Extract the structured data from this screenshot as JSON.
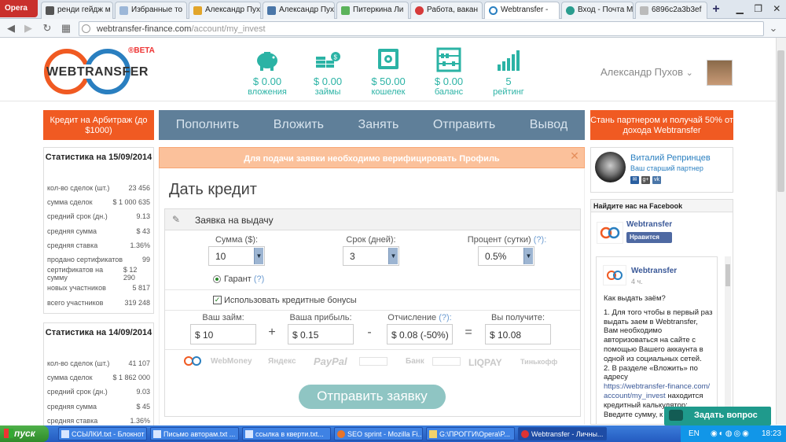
{
  "browser": {
    "opera_label": "Opera",
    "tabs": [
      {
        "label": "ренди гейдж м",
        "active": false
      },
      {
        "label": "Избранные то",
        "active": false
      },
      {
        "label": "Александр Пух",
        "active": false
      },
      {
        "label": "Александр Пух",
        "active": false
      },
      {
        "label": "Питеркина Ли",
        "active": false
      },
      {
        "label": "Работа, вакан",
        "active": false
      },
      {
        "label": "Webtransfer -",
        "active": true
      },
      {
        "label": "Вход - Почта М",
        "active": false
      },
      {
        "label": "6896c2a3b3ef",
        "active": false
      }
    ],
    "new_tab": "+",
    "url_host": "webtransfer-finance.com",
    "url_path": "/account/my_invest"
  },
  "header": {
    "logo_text": "WEBTRANSFER",
    "logo_badge": "®BETA",
    "stats": [
      {
        "icon": "piggy-bank-icon",
        "value": "$ 0.00",
        "label": "вложения"
      },
      {
        "icon": "coins-stack-icon",
        "value": "$ 0.00",
        "label": "займы"
      },
      {
        "icon": "safe-icon",
        "value": "$ 50.00",
        "label": "кошелек"
      },
      {
        "icon": "abacus-icon",
        "value": "$ 0.00",
        "label": "баланс"
      },
      {
        "icon": "rating-chart-icon",
        "value": "5",
        "label": "рейтинг"
      }
    ],
    "username": "Александр Пухов"
  },
  "nav": {
    "credit_arbitrage": "Кредит на Арбитраж (до $1000)",
    "items": [
      "Пополнить",
      "Вложить",
      "Занять",
      "Отправить",
      "Вывод"
    ],
    "partner_promo": "Стань партнером и получай 50% от дохода Webtransfer"
  },
  "stats_blocks": [
    {
      "title": "Статистика на 15/09/2014",
      "rows": [
        [
          "кол-во сделок (шт.)",
          "23 456"
        ],
        [
          "сумма сделок",
          "$ 1 000 635"
        ],
        [
          "средний срок (дн.)",
          "9.13"
        ],
        [
          "средняя сумма",
          "$ 43"
        ],
        [
          "средняя ставка",
          "1.36%"
        ],
        [
          "продано сертификатов",
          "99"
        ],
        [
          "сертификатов на сумму",
          "$ 12 290"
        ],
        [
          "новых участников",
          "5 817"
        ],
        [
          "всего участников",
          "319 248"
        ]
      ]
    },
    {
      "title": "Статистика на 14/09/2014",
      "rows": [
        [
          "кол-во сделок (шт.)",
          "41 107"
        ],
        [
          "сумма сделок",
          "$ 1 862 000"
        ],
        [
          "средний срок (дн.)",
          "9.03"
        ],
        [
          "средняя сумма",
          "$ 45"
        ],
        [
          "средняя ставка",
          "1.36%"
        ]
      ]
    }
  ],
  "main": {
    "alert": "Для подачи заявки необходимо верифицировать Профиль",
    "alert_close": "✕",
    "title": "Дать кредит",
    "form_header": "Заявка на выдачу",
    "sum_label": "Сумма ($):",
    "sum_value": "10",
    "term_label": "Срок (дней):",
    "term_value": "3",
    "percent_label": "Процент (сутки)",
    "percent_q": "(?):",
    "percent_value": "0.5%",
    "guarantee_label": "Гарант",
    "guarantee_q": "(?)",
    "bonus_label": "Использовать кредитные бонусы",
    "loan_label": "Ваш займ:",
    "loan_value": "$ 10",
    "profit_label": "Ваша прибыль:",
    "profit_value": "$ 0.15",
    "deduction_label": "Отчисление",
    "deduction_q": "(?):",
    "deduction_value": "$ 0.08 (-50%)",
    "receive_label": "Вы получите:",
    "receive_value": "$ 10.08",
    "op_plus": "+",
    "op_minus": "-",
    "op_equals": "=",
    "payment_methods": [
      "WebMoney",
      "Яндекс",
      "PayPal",
      "Банк",
      "LIQPAY",
      "Тинькофф"
    ],
    "submit": "Отправить заявку"
  },
  "sidebar": {
    "partner_name": "Виталий Репринцев",
    "partner_role": "Ваш старший партнер",
    "facebook_header": "Найдите нас на Facebook",
    "fb_page": "Webtransfer",
    "fb_like": "Нравится",
    "post_author": "Webtransfer",
    "post_time": "4 ч.",
    "post_question": "Как выдать заём?",
    "post_text_1": "1. Для того чтобы в первый раз выдать заем в Webtransfer, Вам необходимо авторизоваться на сайте с помощью Вашего аккаунта в одной из социальных сетей.",
    "post_text_2": "2. В разделе «Вложить» по адресу",
    "post_link": "https://webtransfer-finance.com/account/my_invest",
    "post_text_3": "находится кредитный калькулятор:",
    "post_text_4": "Введите сумму, к",
    "chat": "Задать вопрос"
  },
  "taskbar": {
    "start": "пуск",
    "tasks": [
      {
        "label": "ССЫЛКИ.txt - Блокнот",
        "active": false
      },
      {
        "label": "Письмо авторам.txt ...",
        "active": false
      },
      {
        "label": "ссылка в кверти.txt...",
        "active": false
      },
      {
        "label": "SEO sprint - Mozilla Fi...",
        "active": false
      },
      {
        "label": "G:\\ПРОГГИ\\Opera\\P...",
        "active": false
      },
      {
        "label": "Webtransfer - Личны...",
        "active": true
      }
    ],
    "lang": "EN",
    "time": "18:23"
  }
}
